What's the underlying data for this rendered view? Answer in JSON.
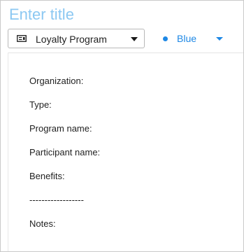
{
  "title_input": {
    "placeholder": "Enter title",
    "value": ""
  },
  "toolbar": {
    "template": {
      "icon": "document-card-icon",
      "label": "Loyalty Program"
    },
    "color": {
      "label": "Blue",
      "swatch": "#1e88e5"
    }
  },
  "body": {
    "fields": [
      "Organization:",
      "Type:",
      "Program name:",
      "Participant name:",
      "Benefits:",
      "------------------",
      "Notes:"
    ]
  }
}
